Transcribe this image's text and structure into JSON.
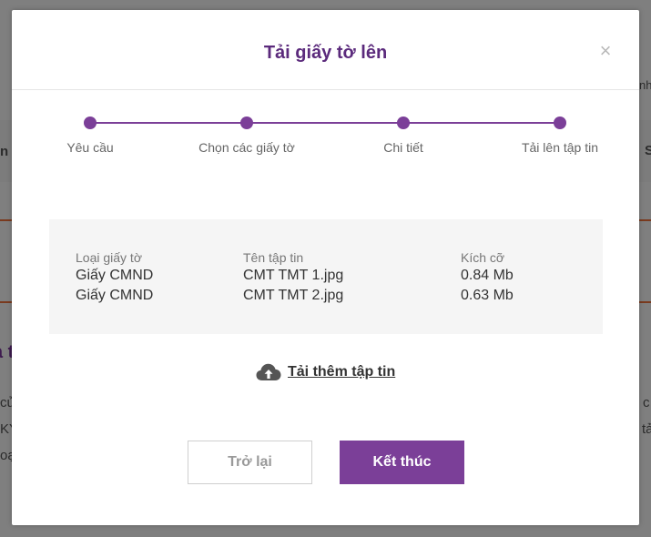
{
  "background": {
    "left_fragments": [
      "n",
      "a t",
      "cử",
      "KY",
      "oạn"
    ],
    "right_fragments": [
      "nh",
      "S",
      "c",
      "tả"
    ]
  },
  "modal": {
    "title": "Tải giấy tờ lên",
    "close_symbol": "×"
  },
  "stepper": {
    "color": "#7b3f98",
    "steps": [
      {
        "label": "Yêu cầu"
      },
      {
        "label": "Chọn các giấy tờ"
      },
      {
        "label": "Chi tiết"
      },
      {
        "label": "Tải lên tập tin"
      }
    ]
  },
  "files": {
    "headers": {
      "type": "Loại giấy tờ",
      "name": "Tên tập tin",
      "size": "Kích cỡ"
    },
    "rows": [
      {
        "type": "Giấy CMND",
        "name": "CMT TMT 1.jpg",
        "size": "0.84 Mb"
      },
      {
        "type": "Giấy CMND",
        "name": "CMT TMT 2.jpg",
        "size": "0.63 Mb"
      }
    ]
  },
  "upload_more": {
    "icon": "cloud-upload-icon",
    "label": "Tải thêm tập tin"
  },
  "actions": {
    "back_label": "Trở lại",
    "finish_label": "Kết thúc",
    "accent": "#7b3f98"
  }
}
